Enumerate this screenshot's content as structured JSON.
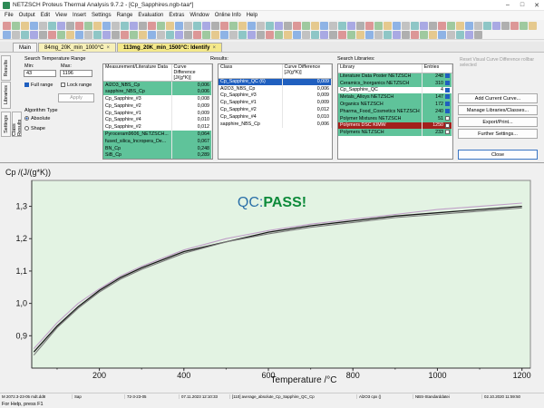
{
  "window": {
    "title": "NETZSCH Proteus Thermal Analysis 9.7.2 - [Cp_Sapphires.ngb-taa*]"
  },
  "menu": [
    "File",
    "Output",
    "Edit",
    "View",
    "Insert",
    "Settings",
    "Range",
    "Evaluation",
    "Extras",
    "Window",
    "Online Info",
    "Help"
  ],
  "tabs": [
    {
      "label": "Main",
      "active": false
    },
    {
      "label": "84mg_20K_min_1000°C",
      "active": false
    },
    {
      "label": "113mg_20K_min_1500°C: Identify",
      "active": true
    }
  ],
  "side_tabs": [
    "Results",
    "Libraries",
    "Settings",
    "Class Results"
  ],
  "search_range": {
    "title": "Search Temperature Range",
    "min_label": "Min:",
    "max_label": "Max:",
    "min_value": "43",
    "max_value": "1196",
    "full_range": "Full range",
    "lock_range": "Lock range",
    "apply": "Apply"
  },
  "algorithm": {
    "title": "Algorithm Type",
    "absolute": "Absolute",
    "shape": "Shape"
  },
  "results_label": "Results:",
  "measurement_table": {
    "col1": "Measurement/Literature Data",
    "col2": "Curve Difference [J/(g*K)]",
    "rows": [
      {
        "name": "Al2O3_NBS_Cp",
        "val": "0,006",
        "style": "g"
      },
      {
        "name": "sapphire_NBS_Cp",
        "val": "0,006",
        "style": "g"
      },
      {
        "name": "Cp_Sapphire_#3",
        "val": "0,008",
        "style": ""
      },
      {
        "name": "Cp_Sapphire_#2",
        "val": "0,009",
        "style": ""
      },
      {
        "name": "Cp_Sapphire_#1",
        "val": "0,009",
        "style": ""
      },
      {
        "name": "Cp_Sapphire_#4",
        "val": "0,010",
        "style": ""
      },
      {
        "name": "Cp_Sapphire_#2",
        "val": "0,012",
        "style": ""
      },
      {
        "name": "Pyroceram9606_NETZSCH...",
        "val": "0,064",
        "style": "g"
      },
      {
        "name": "fused_silica_Incropera_De...",
        "val": "0,067",
        "style": "g"
      },
      {
        "name": "BN_Cp",
        "val": "0,248",
        "style": "g"
      },
      {
        "name": "SiB_Cp",
        "val": "0,289",
        "style": "g"
      }
    ]
  },
  "class_table": {
    "col1": "Class",
    "col2": "Curve Difference [J/(g*K)]",
    "rows": [
      {
        "name": "Cp_Sapphire_QC  (6)",
        "val": "0,009",
        "style": "sel"
      },
      {
        "name": "Al2O3_NBS_Cp",
        "val": "0,006",
        "style": ""
      },
      {
        "name": "Cp_Sapphire_#3",
        "val": "0,009",
        "style": ""
      },
      {
        "name": "Cp_Sapphire_#1",
        "val": "0,009",
        "style": ""
      },
      {
        "name": "Cp_Sapphire_#2",
        "val": "0,012",
        "style": ""
      },
      {
        "name": "Cp_Sapphire_#4",
        "val": "0,010",
        "style": ""
      },
      {
        "name": "sapphire_NBS_Cp",
        "val": "0,006",
        "style": ""
      }
    ]
  },
  "search_libraries": {
    "title": "Search Libraries:",
    "col1": "Library",
    "col2": "Entries",
    "rows": [
      {
        "name": "Literature Data Poster NETZSCH",
        "val": "248",
        "style": "g",
        "checked": true
      },
      {
        "name": "Ceramics_Inorganics NETZSCH",
        "val": "310",
        "style": "g",
        "checked": true
      },
      {
        "name": "Cp_Sapphire_QC",
        "val": "4",
        "style": "",
        "checked": true
      },
      {
        "name": "Metals_Alloys NETZSCH",
        "val": "147",
        "style": "g",
        "checked": true
      },
      {
        "name": "Organics NETZSCH",
        "val": "172",
        "style": "g",
        "checked": true
      },
      {
        "name": "Pharma_Food_Cosmetics NETZSCH",
        "val": "240",
        "style": "g",
        "checked": true
      },
      {
        "name": "Polymer Mixtures NETZSCH",
        "val": "51",
        "style": "g",
        "checked": false
      },
      {
        "name": "Polymers DSC KIMW",
        "val": "1250",
        "style": "red",
        "checked": false
      },
      {
        "name": "Polymers NETZSCH",
        "val": "233",
        "style": "g",
        "checked": false
      }
    ]
  },
  "right_note": "Reset Visual Curve Difference rollbar selected",
  "right_buttons": [
    "Add Current Curve...",
    "Manage Libraries/Classes...",
    "Export/Print...",
    "Further Settings...",
    "Close"
  ],
  "chart_data": {
    "type": "line",
    "title": "QC:PASS!",
    "title_parts": {
      "prefix": "QC:",
      "status": "PASS!"
    },
    "xlabel": "Temperature /°C",
    "ylabel": "Cp /(J/(g*K))",
    "xlim": [
      40,
      1220
    ],
    "ylim": [
      0.8,
      1.38
    ],
    "xticks": [
      200,
      400,
      600,
      800,
      1000,
      1200
    ],
    "yticks": [
      0.9,
      1.0,
      1.1,
      1.2,
      1.3
    ],
    "ytick_labels": [
      "0,9",
      "1,0",
      "1,1",
      "1,2",
      "1,3"
    ],
    "series": [
      {
        "x": [
          45,
          100,
          150,
          200,
          250,
          300,
          400,
          500,
          600,
          700,
          800,
          900,
          1000,
          1100,
          1200
        ],
        "values": [
          0.85,
          0.93,
          0.99,
          1.04,
          1.08,
          1.11,
          1.16,
          1.19,
          1.22,
          1.24,
          1.255,
          1.27,
          1.28,
          1.29,
          1.3
        ],
        "color": "#1a1a1a"
      },
      {
        "x": [
          45,
          100,
          150,
          200,
          250,
          300,
          400,
          500,
          600,
          700,
          800,
          900,
          1000,
          1100,
          1200
        ],
        "values": [
          0.86,
          0.94,
          1.0,
          1.045,
          1.085,
          1.115,
          1.165,
          1.2,
          1.225,
          1.245,
          1.26,
          1.275,
          1.29,
          1.3,
          1.31
        ],
        "color": "#c0a0c8"
      },
      {
        "x": [
          45,
          100,
          150,
          200,
          250,
          300,
          400,
          500,
          600,
          700,
          800,
          900,
          1000,
          1100,
          1200
        ],
        "values": [
          0.84,
          0.925,
          0.985,
          1.035,
          1.075,
          1.105,
          1.155,
          1.19,
          1.215,
          1.235,
          1.25,
          1.265,
          1.275,
          1.285,
          1.295
        ],
        "color": "#7a7a7a"
      }
    ],
    "grid": false,
    "background": "#e3f3e3",
    "qc_color": "#2a6fa8",
    "pass_color": "#0d8a3a"
  },
  "status_bar": [
    "M 2072.3-23-05 mdt.dd8",
    "Sap",
    "72-3-23-05",
    "07.11.2023 12:10:33",
    "[110] average_absolute_Cp_Sapphire_QC_Cp",
    "Al2O3 cpx ()",
    "NBS-Standarddatei",
    "02.10.2020 11:59:50"
  ],
  "help_text": "For Help, press F1"
}
